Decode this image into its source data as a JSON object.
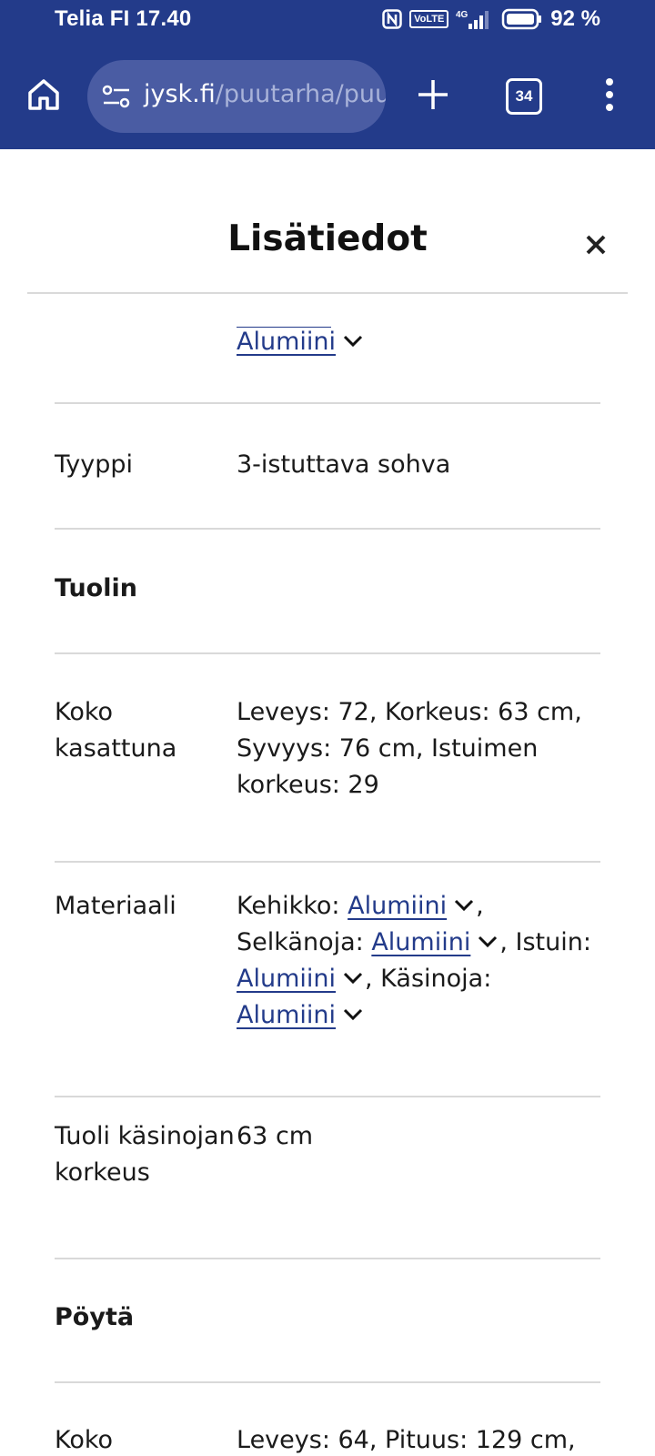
{
  "status_bar": {
    "carrier_time": "Telia FI 17.40",
    "network": "4G",
    "volte": "VoLTE",
    "battery": "92 %"
  },
  "browser": {
    "url_domain": "jysk.fi",
    "url_path": "/puutarha/puut",
    "tab_count": "34"
  },
  "sheet": {
    "title": "Lisätiedot"
  },
  "rows": {
    "top_partial_link": "Alumiini",
    "tyyppi_label": "Tyyppi",
    "tyyppi_value": "3-istuttava sohva",
    "tuolin_heading": "Tuolin",
    "koko_label_1": "Koko",
    "koko_label_2": "kasattuna",
    "koko_value_1": "Leveys: 72, Korkeus: 63 cm,",
    "koko_value_2": "Syvyys: 76 cm, Istuimen",
    "koko_value_3": "korkeus: 29",
    "materiaali_label": "Materiaali",
    "mat_kehikko": "Kehikko:",
    "mat_kehikko_link": "Alumiini",
    "mat_comma1": ",",
    "mat_selkanoja": "Selkänoja:",
    "mat_selkanoja_link": "Alumiini",
    "mat_istuin": ", Istuin:",
    "mat_istuin_link": "Alumiini",
    "mat_kasinoja": ", Käsinoja:",
    "mat_kasinoja_link": "Alumiini",
    "armrest_label_1": "Tuoli käsinojan",
    "armrest_label_2": "korkeus",
    "armrest_value": "63 cm",
    "poyta_heading": "Pöytä",
    "koko2_label": "Koko",
    "koko2_value": "Leveys: 64, Pituus: 129 cm,"
  }
}
